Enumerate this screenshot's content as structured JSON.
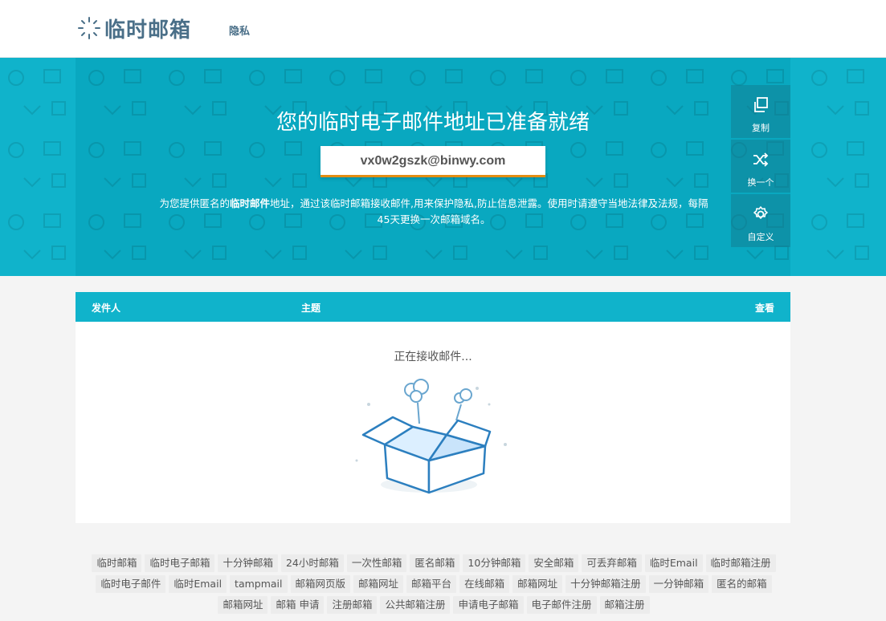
{
  "header": {
    "logo_text": "临时邮箱",
    "nav_privacy": "隐私"
  },
  "hero": {
    "title": "您的临时电子邮件地址已准备就绪",
    "email": "vx0w2gszk@binwy.com",
    "desc_prefix": "为您提供匿名的",
    "desc_bold": "临时邮件",
    "desc_suffix": "地址，通过该临时邮箱接收邮件,用来保护隐私,防止信息泄露。使用时请遵守当地法律及法规，每隔45天更换一次邮箱域名。",
    "actions": [
      {
        "label": "复制",
        "icon": "copy-icon"
      },
      {
        "label": "换一个",
        "icon": "shuffle-icon"
      },
      {
        "label": "自定义",
        "icon": "gear-icon"
      }
    ]
  },
  "inbox": {
    "col_sender": "发件人",
    "col_subject": "主题",
    "col_view": "查看",
    "status": "正在接收邮件..."
  },
  "tags": [
    "临时邮箱",
    "临时电子邮箱",
    "十分钟邮箱",
    "24小时邮箱",
    "一次性邮箱",
    "匿名邮箱",
    "10分钟邮箱",
    "安全邮箱",
    "可丢弃邮箱",
    "临时Email",
    "临时邮箱注册",
    "临时电子邮件",
    "临时Email",
    "tampmail",
    "邮箱网页版",
    "邮箱网址",
    "邮箱平台",
    "在线邮箱",
    "邮箱网址",
    "十分钟邮箱注册",
    "一分钟邮箱",
    "匿名的邮箱",
    "邮箱网址",
    "邮箱 申请",
    "注册邮箱",
    "公共邮箱注册",
    "申请电子邮箱",
    "电子邮件注册",
    "邮箱注册"
  ],
  "colors": {
    "brand": "#10b3cb",
    "accent": "#e38d13",
    "logo": "#4a6f88"
  }
}
